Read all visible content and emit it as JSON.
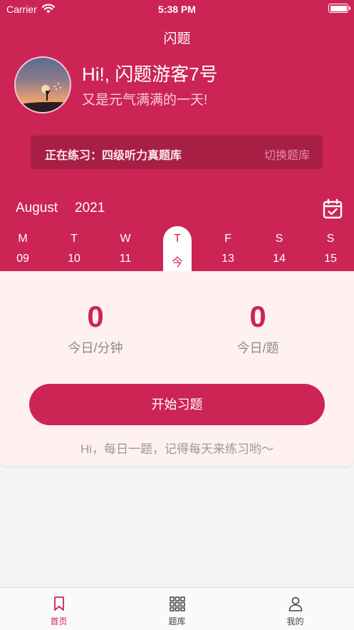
{
  "status_bar": {
    "carrier": "Carrier",
    "time": "5:38 PM"
  },
  "nav": {
    "title": "闪题"
  },
  "profile": {
    "greeting": "Hi!, 闪题游客7号",
    "subtitle": "又是元气满满的一天!"
  },
  "practice": {
    "label": "正在练习：四级听力真题库",
    "switch_label": "切换题库"
  },
  "calendar": {
    "month": "August",
    "year": "2021",
    "days": [
      {
        "dow": "M",
        "num": "09"
      },
      {
        "dow": "T",
        "num": "10"
      },
      {
        "dow": "W",
        "num": "11"
      },
      {
        "dow": "T",
        "num": "今"
      },
      {
        "dow": "F",
        "num": "13"
      },
      {
        "dow": "S",
        "num": "14"
      },
      {
        "dow": "S",
        "num": "15"
      }
    ]
  },
  "stats": {
    "minutes_value": "0",
    "minutes_label": "今日/分钟",
    "questions_value": "0",
    "questions_label": "今日/题"
  },
  "actions": {
    "start_label": "开始习题",
    "tip": "Hi，每日一题，记得每天来练习哟～"
  },
  "tabbar": {
    "items": [
      {
        "label": "首页",
        "icon": "bookmark-icon"
      },
      {
        "label": "题库",
        "icon": "grid-icon"
      },
      {
        "label": "我的",
        "icon": "person-icon"
      }
    ]
  },
  "colors": {
    "accent": "#cc2455",
    "card_bg": "#fff1f1",
    "practice_bar": "#a81f46"
  }
}
